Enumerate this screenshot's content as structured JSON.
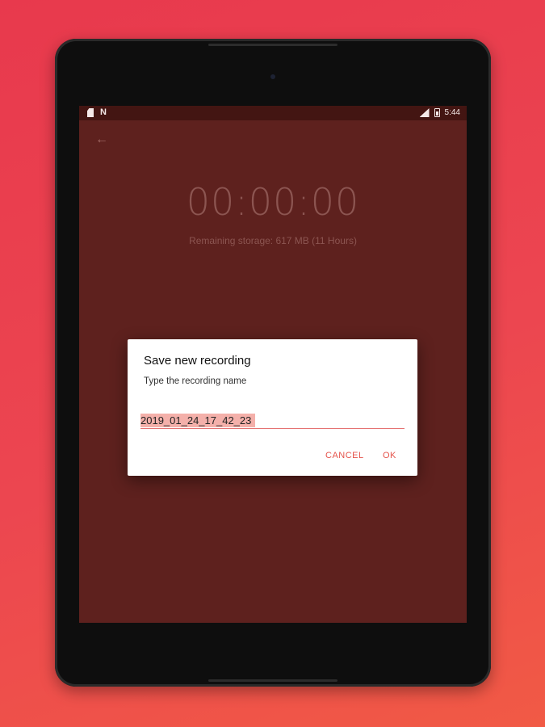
{
  "status_bar": {
    "time": "5:44",
    "left_icons": [
      "sd-card-icon",
      "n-icon"
    ],
    "n_label": "N",
    "right_icons": [
      "signal-icon",
      "battery-icon"
    ]
  },
  "app": {
    "back_icon": "arrow-left-icon",
    "timer": "00:00:00",
    "storage_text": "Remaining storage: 617 MB (11 Hours)",
    "background_color": "#5e211e",
    "accent_color": "#e5534b"
  },
  "dialog": {
    "title": "Save new recording",
    "message": "Type the recording name",
    "input_value": "2019_01_24_17_42_23",
    "cancel_label": "CANCEL",
    "ok_label": "OK"
  }
}
